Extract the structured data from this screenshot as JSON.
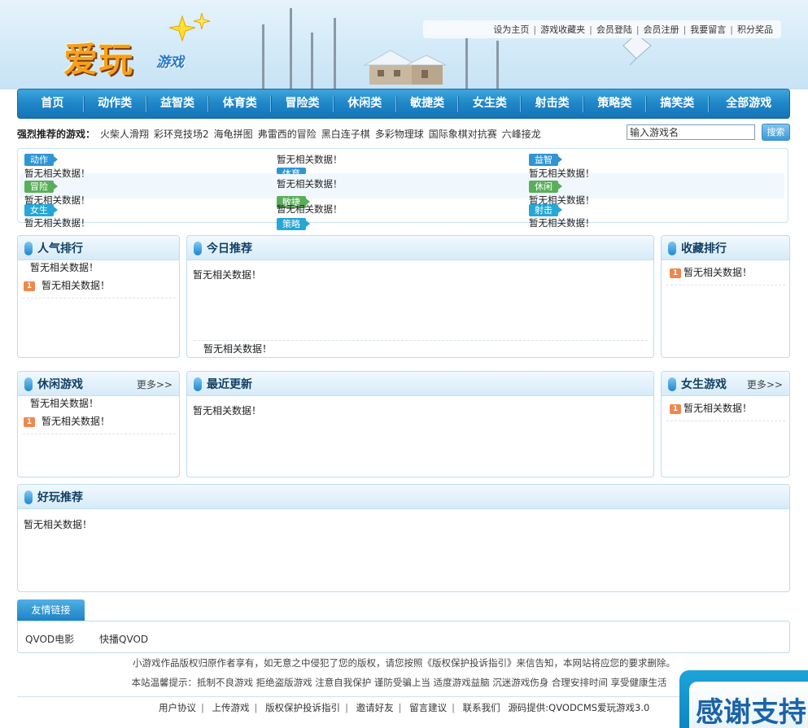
{
  "header": {
    "logo_text": "爱玩",
    "logo_sub": "游戏",
    "top_links": [
      "设为主页",
      "游戏收藏夹",
      "会员登陆",
      "会员注册",
      "我要留言",
      "积分奖品"
    ]
  },
  "nav": {
    "items": [
      "首页",
      "动作类",
      "益智类",
      "体育类",
      "冒险类",
      "休闲类",
      "敏捷类",
      "女生类",
      "射击类",
      "策略类",
      "搞笑类",
      "全部游戏"
    ]
  },
  "recommend": {
    "label": "强烈推荐的游戏：",
    "games": [
      "火柴人滑翔",
      "彩环竞技场2",
      "海龟拼图",
      "弗雷西的冒险",
      "黑白连子棋",
      "多彩物理球",
      "国际象棋对抗赛",
      "六峰接龙"
    ]
  },
  "search": {
    "value": "输入游戏名",
    "button": "搜索"
  },
  "categories": {
    "empty_text": "暂无相关数据！",
    "tags": [
      "动作",
      "体育",
      "益智",
      "冒险",
      "敏捷",
      "休闲",
      "女生",
      "策略",
      "射击"
    ]
  },
  "panels": {
    "popular": {
      "title": "人气排行",
      "empty": "暂无相关数据！",
      "rank": "1"
    },
    "today": {
      "title": "今日推荐",
      "empty": "暂无相关数据！"
    },
    "favorites": {
      "title": "收藏排行",
      "empty": "暂无相关数据！",
      "rank": "1"
    },
    "casual": {
      "title": "休闲游戏",
      "more": "更多>>",
      "empty": "暂无相关数据！",
      "rank": "1"
    },
    "latest": {
      "title": "最近更新",
      "empty": "暂无相关数据！"
    },
    "girls": {
      "title": "女生游戏",
      "more": "更多>>",
      "empty": "暂无相关数据！",
      "rank": "1"
    },
    "fun": {
      "title": "好玩推荐",
      "empty": "暂无相关数据！"
    }
  },
  "friend_links": {
    "tab": "友情链接",
    "links": [
      "QVOD电影",
      "快播QVOD"
    ]
  },
  "footer": {
    "copyright": "小游戏作品版权归原作者享有，如无意之中侵犯了您的版权，请您按照《版权保护投诉指引》来信告知，本网站将应您的要求删除。",
    "notice": "本站温馨提示：抵制不良游戏 拒绝盗版游戏 注意自我保护 谨防受骗上当 适度游戏益脑 沉迷游戏伤身 合理安排时间 享受健康生活",
    "links": [
      "用户协议",
      "上传游戏",
      "版权保护投诉指引",
      "邀请好友",
      "留言建议",
      "联系我们"
    ],
    "powered": "源码提供:QVODCMS爱玩游戏3.0"
  },
  "banner": {
    "text": "感谢支持"
  }
}
